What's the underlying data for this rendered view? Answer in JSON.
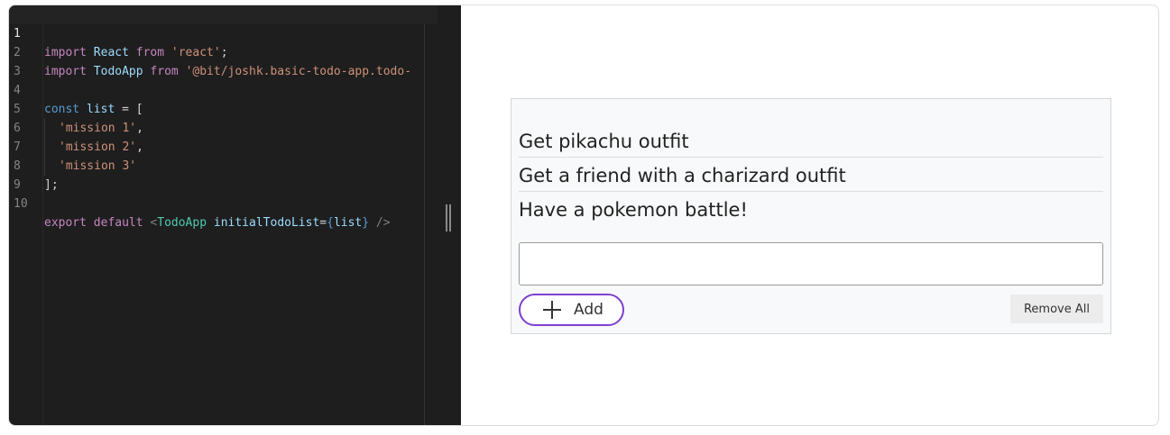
{
  "editor": {
    "line_numbers": [
      "1",
      "2",
      "3",
      "4",
      "5",
      "6",
      "7",
      "8",
      "9",
      "10"
    ],
    "line1": {
      "kw_import": "import",
      "id_react": "React",
      "kw_from": "from",
      "str": "'react'",
      "punc": ";"
    },
    "line2": {
      "kw_import": "import",
      "id_todoapp": "TodoApp",
      "kw_from": "from",
      "str": "'@bit/joshk.basic-todo-app.todo-"
    },
    "line4": {
      "kw_const": "const",
      "id_list": "list",
      "punc": " = ["
    },
    "line5": {
      "str": "'mission 1'",
      "punc": ","
    },
    "line6": {
      "str": "'mission 2'",
      "punc": ","
    },
    "line7": {
      "str": "'mission 3'"
    },
    "line8": {
      "punc": "];"
    },
    "line10": {
      "kw_export": "export",
      "kw_default": "default",
      "lt": "<",
      "tag": "TodoApp",
      "attr": "initialTodoList",
      "eq": "=",
      "lbrace": "{",
      "id_list": "list",
      "rbrace": "}",
      "close": "/>"
    }
  },
  "preview": {
    "todos": [
      "Get pikachu outfit",
      "Get a friend with a charizard outfit",
      "Have a pokemon battle!"
    ],
    "input_value": "",
    "add_label": "Add",
    "remove_all_label": "Remove All"
  },
  "colors": {
    "editor_bg": "#1e1e1e",
    "add_button_border": "#7e3fd0"
  },
  "icons": {
    "add": "plus-icon",
    "pane_divider": "drag-handle-icon"
  }
}
